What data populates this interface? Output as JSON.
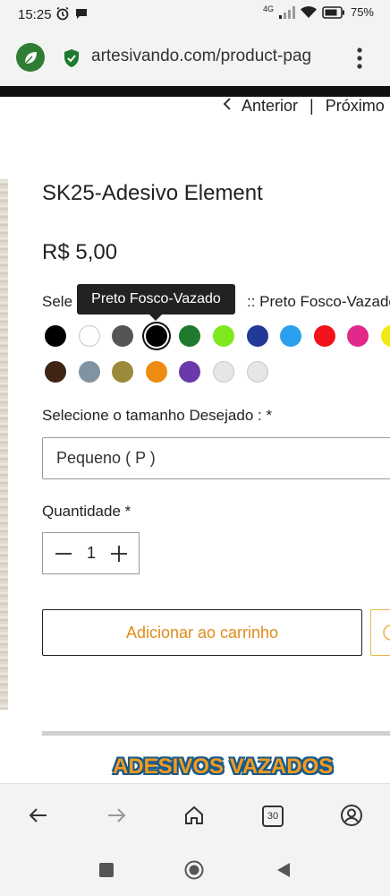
{
  "status_bar": {
    "time": "15:25",
    "network": "4G",
    "battery": "75%",
    "icons": [
      "alarm-icon",
      "chat-bubble-icon",
      "signal-icon",
      "wifi-icon",
      "battery-icon"
    ]
  },
  "browser": {
    "url": "artesivando.com/product-pag",
    "tabs_count": "30",
    "icons": [
      "site-leaf-icon",
      "lock-icon",
      "menu-icon",
      "back-icon",
      "forward-icon",
      "home-icon",
      "tabs-icon",
      "account-icon"
    ]
  },
  "product": {
    "nav_prev": "Anterior",
    "nav_sep": "|",
    "nav_next": "Próximo",
    "title": "SK25-Adesivo Element",
    "price": "R$ 5,00",
    "color_label_start": "Sele",
    "color_label_tail": ":: Preto Fosco-Vazado",
    "tooltip": "Preto Fosco-Vazado",
    "colors": [
      "#000000",
      "#ffffff",
      "#555555",
      "#000000",
      "#1f7a2e",
      "#7fe81e",
      "#22399a",
      "#2aa0ee",
      "#f2121a",
      "#e0298a",
      "#f0ea16",
      "#3e2415",
      "#7f93a2",
      "#9a8a3a",
      "#ee8b12",
      "#6a3aaa",
      "#e6e6e6",
      "#e6e6e6"
    ],
    "selected_color_index": 3,
    "size_label": "Selecione o tamanho Desejado : *",
    "size_value": "Pequeno ( P )",
    "qty_label": "Quantidade *",
    "qty_value": "1",
    "add_to_cart": "Adicionar ao carrinho",
    "banner_text": "ADESIVOS VAZADOS"
  },
  "accent_colors": {
    "cart_text": "#e08c1c",
    "site_icon": "#2e7d32"
  }
}
